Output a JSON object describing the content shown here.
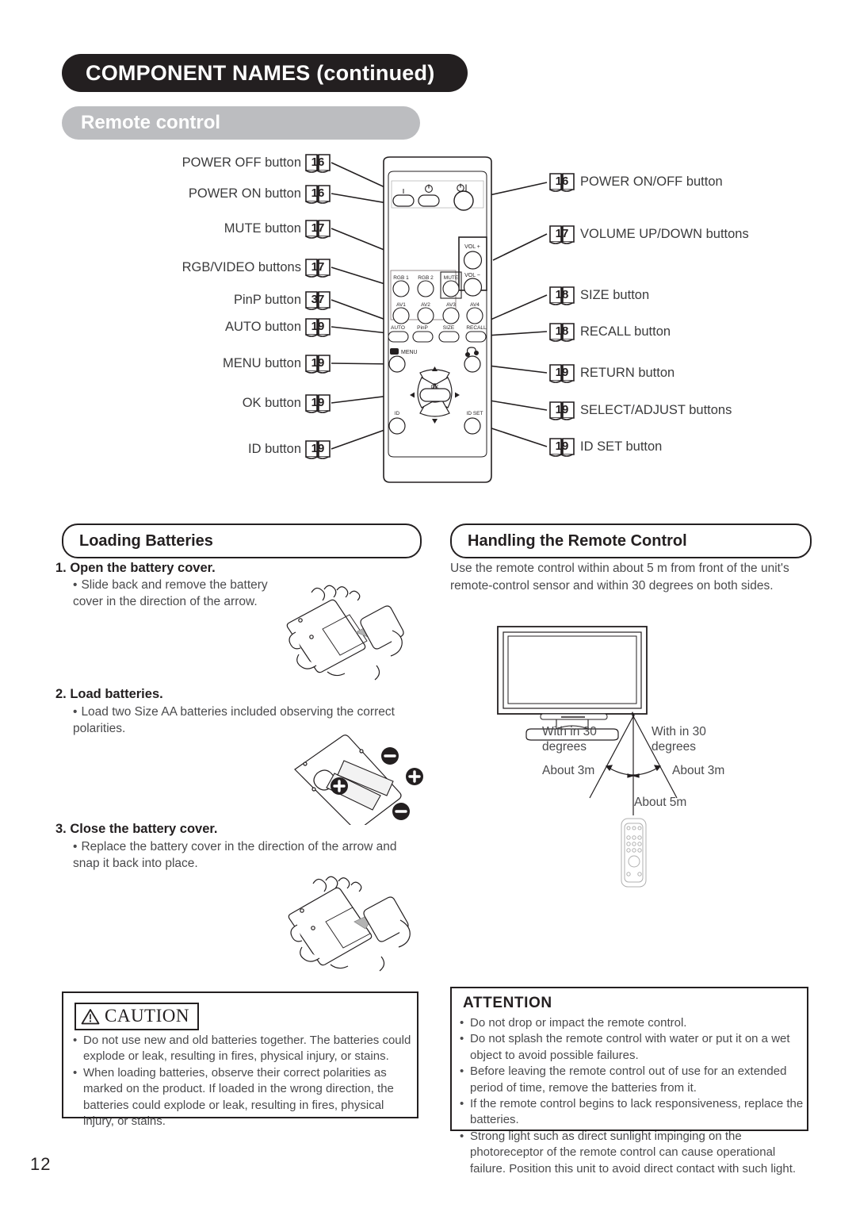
{
  "header": {
    "title": "COMPONENT NAMES (continued)",
    "subtitle": "Remote control"
  },
  "page_number": "12",
  "callouts_left": [
    {
      "label": "POWER OFF button",
      "page": "16"
    },
    {
      "label": "POWER ON button",
      "page": "16"
    },
    {
      "label": "MUTE button",
      "page": "17"
    },
    {
      "label": "RGB/VIDEO buttons",
      "page": "17"
    },
    {
      "label": "PinP button",
      "page": "37"
    },
    {
      "label": "AUTO button",
      "page": "19"
    },
    {
      "label": "MENU button",
      "page": "19"
    },
    {
      "label": "OK button",
      "page": "19"
    },
    {
      "label": "ID button",
      "page": "19"
    }
  ],
  "callouts_right": [
    {
      "label": "POWER ON/OFF button",
      "page": "16"
    },
    {
      "label": "VOLUME UP/DOWN buttons",
      "page": "17"
    },
    {
      "label": "SIZE button",
      "page": "18"
    },
    {
      "label": "RECALL button",
      "page": "18"
    },
    {
      "label": "RETURN button",
      "page": "19"
    },
    {
      "label": "SELECT/ADJUST buttons",
      "page": "19"
    },
    {
      "label": "ID SET button",
      "page": "19"
    }
  ],
  "remote_buttons": {
    "power_on_symbol": "⏻",
    "power_onoff_symbol": "⏻|",
    "vol_up": "VOL  +",
    "vol_down": "VOL  −",
    "rgb1": "RGB 1",
    "rgb2": "RGB 2",
    "mute": "MUTE",
    "av1": "AV1",
    "av2": "AV2",
    "av3": "AV3",
    "av4": "AV4",
    "auto": "AUTO",
    "pinp": "PinP",
    "size": "SIZE",
    "recall": "RECALL",
    "menu": "MENU",
    "ok": "OK",
    "id": "ID",
    "id_set": "ID SET"
  },
  "loading_batteries": {
    "heading": "Loading Batteries",
    "steps": [
      {
        "title": "1. Open the battery cover.",
        "body": "Slide back and remove the battery cover in the direction of the arrow."
      },
      {
        "title": "2. Load batteries.",
        "body": "Load two Size AA batteries included observing the correct polarities."
      },
      {
        "title": "3. Close the battery cover.",
        "body": "Replace the battery cover in the direction of the arrow and snap it back into place."
      }
    ]
  },
  "handling": {
    "heading": "Handling the Remote Control",
    "paragraph": "Use the remote control within about 5 m from front of the unit's remote-control sensor and within 30 degrees on both sides.",
    "labels": {
      "within_left": "With in 30\ndegrees",
      "within_right": "With in 30\ndegrees",
      "about3m_left": "About 3m",
      "about3m_right": "About 3m",
      "about5m": "About 5m"
    }
  },
  "caution": {
    "title": "CAUTION",
    "items": [
      "Do not use new and old batteries together.  The batteries could explode or leak, resulting in fires, physical injury, or stains.",
      "When loading batteries, observe their correct polarities as marked on the product. If loaded in the wrong direction, the batteries could explode or leak, resulting in fires, physical injury, or stains."
    ]
  },
  "attention": {
    "title": "ATTENTION",
    "items": [
      "Do not drop or impact the remote control.",
      "Do not splash the remote control with water or put it on a wet object to avoid possible failures.",
      "Before leaving the remote control out of use for an extended period of time, remove the batteries from it.",
      "If the remote control begins to lack responsiveness, replace the batteries.",
      "Strong light such as direct sunlight impinging on the photoreceptor of the remote control can cause operational failure. Position this unit to avoid direct contact with such light."
    ]
  },
  "colors": {
    "ink": "#231f20",
    "body_text": "#4a4a4c",
    "subtitle_band": "#bcbdc0"
  }
}
